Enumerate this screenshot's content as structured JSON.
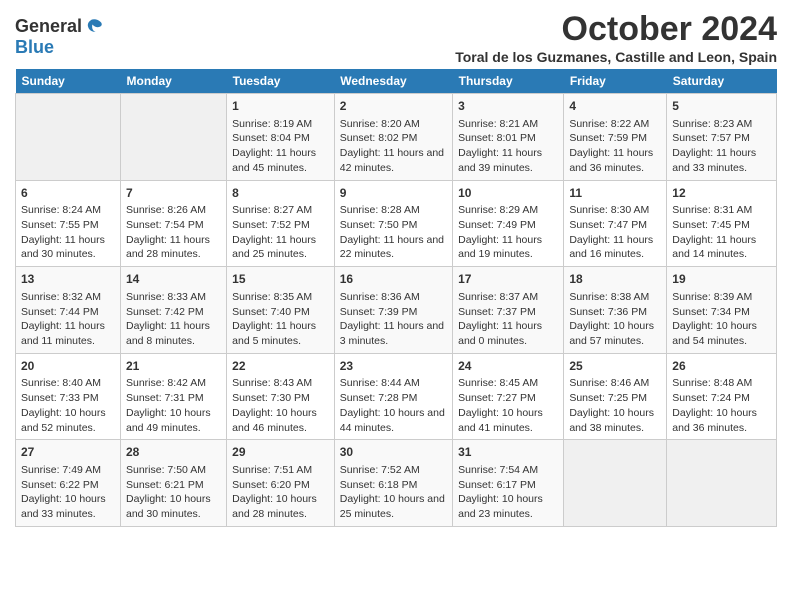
{
  "logo": {
    "general": "General",
    "blue": "Blue"
  },
  "title": "October 2024",
  "subtitle": "Toral de los Guzmanes, Castille and Leon, Spain",
  "days_header": [
    "Sunday",
    "Monday",
    "Tuesday",
    "Wednesday",
    "Thursday",
    "Friday",
    "Saturday"
  ],
  "weeks": [
    [
      {
        "day": "",
        "sunrise": "",
        "sunset": "",
        "daylight": ""
      },
      {
        "day": "",
        "sunrise": "",
        "sunset": "",
        "daylight": ""
      },
      {
        "day": "1",
        "sunrise": "Sunrise: 8:19 AM",
        "sunset": "Sunset: 8:04 PM",
        "daylight": "Daylight: 11 hours and 45 minutes."
      },
      {
        "day": "2",
        "sunrise": "Sunrise: 8:20 AM",
        "sunset": "Sunset: 8:02 PM",
        "daylight": "Daylight: 11 hours and 42 minutes."
      },
      {
        "day": "3",
        "sunrise": "Sunrise: 8:21 AM",
        "sunset": "Sunset: 8:01 PM",
        "daylight": "Daylight: 11 hours and 39 minutes."
      },
      {
        "day": "4",
        "sunrise": "Sunrise: 8:22 AM",
        "sunset": "Sunset: 7:59 PM",
        "daylight": "Daylight: 11 hours and 36 minutes."
      },
      {
        "day": "5",
        "sunrise": "Sunrise: 8:23 AM",
        "sunset": "Sunset: 7:57 PM",
        "daylight": "Daylight: 11 hours and 33 minutes."
      }
    ],
    [
      {
        "day": "6",
        "sunrise": "Sunrise: 8:24 AM",
        "sunset": "Sunset: 7:55 PM",
        "daylight": "Daylight: 11 hours and 30 minutes."
      },
      {
        "day": "7",
        "sunrise": "Sunrise: 8:26 AM",
        "sunset": "Sunset: 7:54 PM",
        "daylight": "Daylight: 11 hours and 28 minutes."
      },
      {
        "day": "8",
        "sunrise": "Sunrise: 8:27 AM",
        "sunset": "Sunset: 7:52 PM",
        "daylight": "Daylight: 11 hours and 25 minutes."
      },
      {
        "day": "9",
        "sunrise": "Sunrise: 8:28 AM",
        "sunset": "Sunset: 7:50 PM",
        "daylight": "Daylight: 11 hours and 22 minutes."
      },
      {
        "day": "10",
        "sunrise": "Sunrise: 8:29 AM",
        "sunset": "Sunset: 7:49 PM",
        "daylight": "Daylight: 11 hours and 19 minutes."
      },
      {
        "day": "11",
        "sunrise": "Sunrise: 8:30 AM",
        "sunset": "Sunset: 7:47 PM",
        "daylight": "Daylight: 11 hours and 16 minutes."
      },
      {
        "day": "12",
        "sunrise": "Sunrise: 8:31 AM",
        "sunset": "Sunset: 7:45 PM",
        "daylight": "Daylight: 11 hours and 14 minutes."
      }
    ],
    [
      {
        "day": "13",
        "sunrise": "Sunrise: 8:32 AM",
        "sunset": "Sunset: 7:44 PM",
        "daylight": "Daylight: 11 hours and 11 minutes."
      },
      {
        "day": "14",
        "sunrise": "Sunrise: 8:33 AM",
        "sunset": "Sunset: 7:42 PM",
        "daylight": "Daylight: 11 hours and 8 minutes."
      },
      {
        "day": "15",
        "sunrise": "Sunrise: 8:35 AM",
        "sunset": "Sunset: 7:40 PM",
        "daylight": "Daylight: 11 hours and 5 minutes."
      },
      {
        "day": "16",
        "sunrise": "Sunrise: 8:36 AM",
        "sunset": "Sunset: 7:39 PM",
        "daylight": "Daylight: 11 hours and 3 minutes."
      },
      {
        "day": "17",
        "sunrise": "Sunrise: 8:37 AM",
        "sunset": "Sunset: 7:37 PM",
        "daylight": "Daylight: 11 hours and 0 minutes."
      },
      {
        "day": "18",
        "sunrise": "Sunrise: 8:38 AM",
        "sunset": "Sunset: 7:36 PM",
        "daylight": "Daylight: 10 hours and 57 minutes."
      },
      {
        "day": "19",
        "sunrise": "Sunrise: 8:39 AM",
        "sunset": "Sunset: 7:34 PM",
        "daylight": "Daylight: 10 hours and 54 minutes."
      }
    ],
    [
      {
        "day": "20",
        "sunrise": "Sunrise: 8:40 AM",
        "sunset": "Sunset: 7:33 PM",
        "daylight": "Daylight: 10 hours and 52 minutes."
      },
      {
        "day": "21",
        "sunrise": "Sunrise: 8:42 AM",
        "sunset": "Sunset: 7:31 PM",
        "daylight": "Daylight: 10 hours and 49 minutes."
      },
      {
        "day": "22",
        "sunrise": "Sunrise: 8:43 AM",
        "sunset": "Sunset: 7:30 PM",
        "daylight": "Daylight: 10 hours and 46 minutes."
      },
      {
        "day": "23",
        "sunrise": "Sunrise: 8:44 AM",
        "sunset": "Sunset: 7:28 PM",
        "daylight": "Daylight: 10 hours and 44 minutes."
      },
      {
        "day": "24",
        "sunrise": "Sunrise: 8:45 AM",
        "sunset": "Sunset: 7:27 PM",
        "daylight": "Daylight: 10 hours and 41 minutes."
      },
      {
        "day": "25",
        "sunrise": "Sunrise: 8:46 AM",
        "sunset": "Sunset: 7:25 PM",
        "daylight": "Daylight: 10 hours and 38 minutes."
      },
      {
        "day": "26",
        "sunrise": "Sunrise: 8:48 AM",
        "sunset": "Sunset: 7:24 PM",
        "daylight": "Daylight: 10 hours and 36 minutes."
      }
    ],
    [
      {
        "day": "27",
        "sunrise": "Sunrise: 7:49 AM",
        "sunset": "Sunset: 6:22 PM",
        "daylight": "Daylight: 10 hours and 33 minutes."
      },
      {
        "day": "28",
        "sunrise": "Sunrise: 7:50 AM",
        "sunset": "Sunset: 6:21 PM",
        "daylight": "Daylight: 10 hours and 30 minutes."
      },
      {
        "day": "29",
        "sunrise": "Sunrise: 7:51 AM",
        "sunset": "Sunset: 6:20 PM",
        "daylight": "Daylight: 10 hours and 28 minutes."
      },
      {
        "day": "30",
        "sunrise": "Sunrise: 7:52 AM",
        "sunset": "Sunset: 6:18 PM",
        "daylight": "Daylight: 10 hours and 25 minutes."
      },
      {
        "day": "31",
        "sunrise": "Sunrise: 7:54 AM",
        "sunset": "Sunset: 6:17 PM",
        "daylight": "Daylight: 10 hours and 23 minutes."
      },
      {
        "day": "",
        "sunrise": "",
        "sunset": "",
        "daylight": ""
      },
      {
        "day": "",
        "sunrise": "",
        "sunset": "",
        "daylight": ""
      }
    ]
  ]
}
